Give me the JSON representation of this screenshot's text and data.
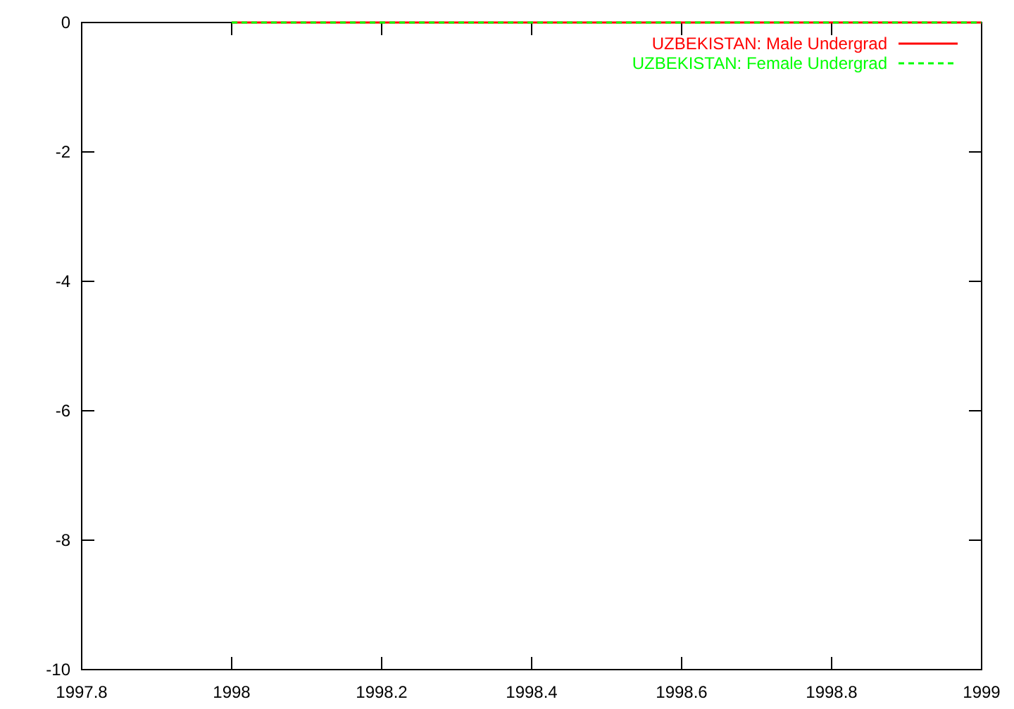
{
  "chart": {
    "chart_data": {
      "type": "line",
      "x": [
        1998,
        1999
      ],
      "series": [
        {
          "name": "UZBEKISTAN: Male Undergrad",
          "color": "#ff0000",
          "line_style": "solid",
          "values": [
            0,
            0
          ]
        },
        {
          "name": "UZBEKISTAN: Female Undergrad",
          "color": "#00ff00",
          "line_style": "dashed",
          "values": [
            0,
            0
          ]
        }
      ],
      "legend": true,
      "xlim": [
        1997.8,
        1999
      ],
      "ylim": [
        -10,
        0
      ],
      "xticks": [
        {
          "value": 1997.8,
          "label": "1997.8"
        },
        {
          "value": 1998,
          "label": "1998"
        },
        {
          "value": 1998.2,
          "label": "1998.2"
        },
        {
          "value": 1998.4,
          "label": "1998.4"
        },
        {
          "value": 1998.6,
          "label": "1998.6"
        },
        {
          "value": 1998.8,
          "label": "1998.8"
        },
        {
          "value": 1999,
          "label": "1999"
        }
      ],
      "yticks": [
        {
          "value": 0,
          "label": "0"
        },
        {
          "value": -2,
          "label": "-2"
        },
        {
          "value": -4,
          "label": "-4"
        },
        {
          "value": -6,
          "label": "-6"
        },
        {
          "value": -8,
          "label": "-8"
        },
        {
          "value": -10,
          "label": "-10"
        }
      ]
    }
  }
}
